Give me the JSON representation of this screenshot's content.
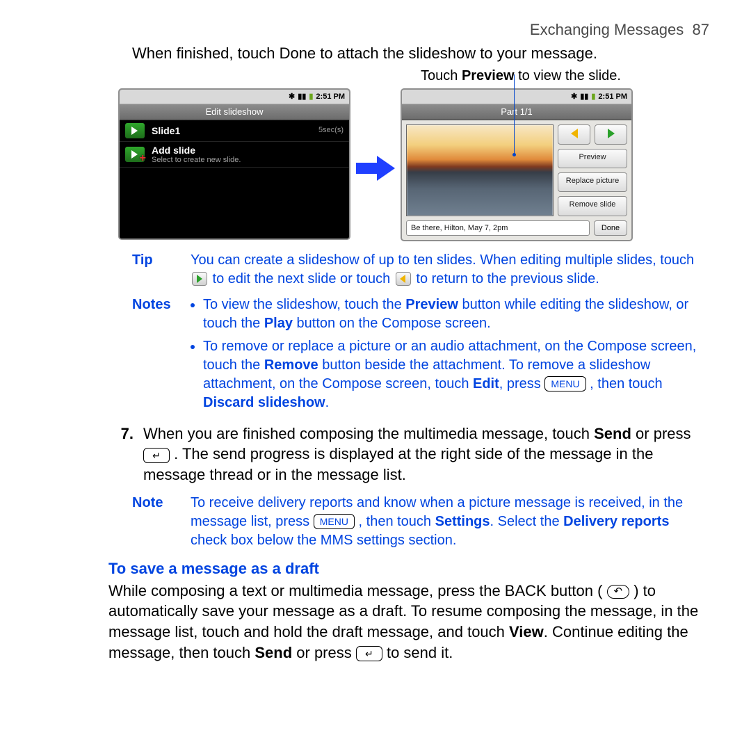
{
  "header": {
    "section": "Exchanging Messages",
    "page": "87"
  },
  "intro": "When finished, touch Done to attach the slideshow to your message.",
  "callout": {
    "caption_before": "Touch ",
    "caption_bold": "Preview",
    "caption_after": " to view the slide."
  },
  "left_screen": {
    "time": "2:51 PM",
    "title": "Edit slideshow",
    "rows": [
      {
        "title": "Slide1",
        "meta": "5sec(s)"
      },
      {
        "title": "Add slide",
        "sub": "Select to create new slide."
      }
    ]
  },
  "right_screen": {
    "time": "2:51 PM",
    "title": "Part 1/1",
    "buttons": {
      "preview": "Preview",
      "replace": "Replace picture",
      "remove": "Remove slide",
      "done": "Done"
    },
    "textbox": "Be there, Hilton, May 7, 2pm"
  },
  "tip": {
    "label": "Tip",
    "text_a": "You can create a slideshow of up to ten slides. When editing multiple slides, touch ",
    "text_b": " to edit the next slide or touch ",
    "text_c": " to return to the previous slide."
  },
  "notes": {
    "label": "Notes",
    "items": [
      "To view the slideshow, touch the <b>Preview</b> button while editing the slideshow, or touch the <b>Play</b> button on the Compose screen.",
      "To remove or replace a picture or an audio attachment, on the Compose screen, touch the <b>Remove</b> button beside the attachment. To remove a slideshow attachment, on the Compose screen, touch <b>Edit</b>, press <span class='inline-key'>MENU</span> , then touch <b>Discard slideshow</b>."
    ]
  },
  "step7": {
    "num": "7.",
    "text_a": "When you are finished composing the multimedia message, touch ",
    "bold_send": "Send",
    "text_b": " or press ",
    "text_c": " . The send progress is displayed at the right side of the message in the message thread or in the message list."
  },
  "note_single": {
    "label": "Note",
    "text": "To receive delivery reports and know when a picture message is received, in the message list, press <span class='inline-key'>MENU</span> , then touch <b>Settings</b>. Select the <b>Delivery reports</b> check box below the MMS settings section."
  },
  "draft": {
    "heading": "To save a message as a draft",
    "para_a": "While composing a text or multimedia message, press the BACK button ( ",
    "para_b": " ) to automatically save your message as a draft. To resume composing the message, in the message list, touch and hold the draft message, and touch ",
    "bold_view": "View",
    "para_c": ". Continue editing the message, then touch ",
    "bold_send": "Send",
    "para_d": " or press ",
    "para_e": " to send it."
  },
  "keys": {
    "enter": "↵",
    "back": "↶",
    "menu": "MENU"
  }
}
